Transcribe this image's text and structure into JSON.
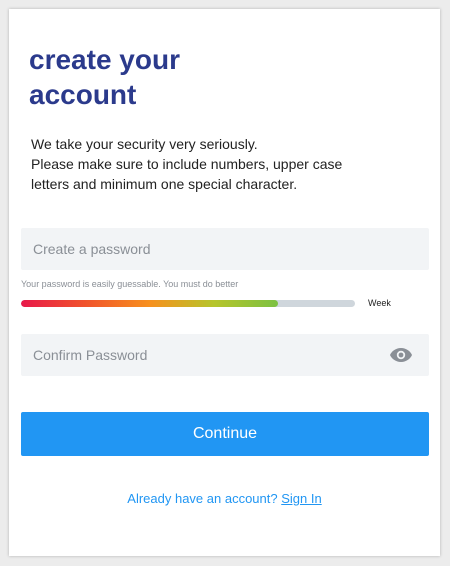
{
  "title": "create your account",
  "description": {
    "line1": "We take your security very seriously.",
    "line2": "Please make sure to include numbers, upper case",
    "line3": "letters and minimum one special character."
  },
  "password": {
    "placeholder": "Create a password",
    "value": "",
    "hint": "Your password is easily guessable. You must do better",
    "strength_fraction": 0.77,
    "strength_label": "Week"
  },
  "confirm": {
    "placeholder": "Confirm Password",
    "value": "",
    "icon": "eye-icon"
  },
  "continue_label": "Continue",
  "footer": {
    "prompt": "Already have an account?",
    "link_label": "Sign In"
  },
  "colors": {
    "title": "#2b3a8c",
    "accent": "#2196f3",
    "field_bg": "#f2f4f6"
  }
}
